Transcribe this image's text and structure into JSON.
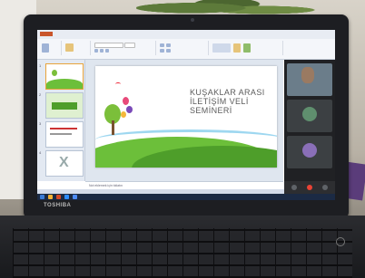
{
  "device": {
    "brand": "TOSHIBA"
  },
  "ppt": {
    "tabs": [
      "",
      "",
      "",
      "",
      "",
      "",
      "",
      ""
    ],
    "slide": {
      "title_line1": "KUŞAKLAR ARASI",
      "title_line2": "İLETİŞİM VELİ",
      "title_line3": "SEMİNERİ",
      "subtitle": ""
    },
    "thumbnails": [
      "1",
      "2",
      "3",
      "4"
    ],
    "notes_placeholder": "Not eklemek için tıklatın"
  },
  "meet": {
    "participants": [
      {
        "name": ""
      },
      {
        "name": ""
      },
      {
        "name": ""
      }
    ]
  },
  "colors": {
    "accent": "#e8a33a",
    "taskbar": "#1b2a44",
    "meet_bg": "#202124"
  }
}
